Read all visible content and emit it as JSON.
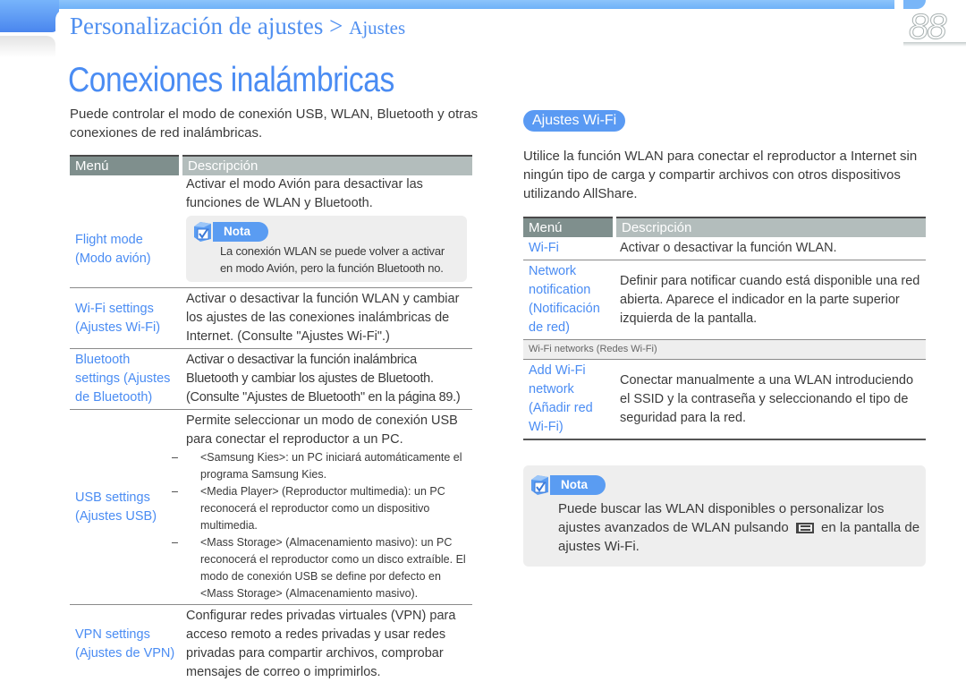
{
  "header": {
    "breadcrumb_main": "Personalización de ajustes",
    "breadcrumb_separator": " > ",
    "breadcrumb_sub": "Ajustes",
    "page_number": "88"
  },
  "title": "Conexiones inalámbricas",
  "intro": "Puede controlar el modo de conexión USB, WLAN, Bluetooth y otras conexiones de red inalámbricas.",
  "left_table": {
    "headers": {
      "menu": "Menú",
      "description": "Descripción"
    },
    "rows": [
      {
        "menu": "Flight mode (Modo avión)",
        "description": "Activar el modo Avión para desactivar las funciones de WLAN y Bluetooth.",
        "note": {
          "label": "Nota",
          "text": "La conexión WLAN se puede volver a activar en modo Avión, pero la función Bluetooth no."
        }
      },
      {
        "menu": "Wi-Fi settings (Ajustes Wi-Fi)",
        "description": "Activar o desactivar la función WLAN y cambiar los ajustes de las conexiones inalámbricas de Internet. (Consulte \"Ajustes Wi-Fi\".)"
      },
      {
        "menu": "Bluetooth settings (Ajustes de Bluetooth)",
        "description": "Activar o desactivar la función inalámbrica Bluetooth y cambiar los ajustes de Bluetooth. (Consulte \"Ajustes de Bluetooth\" en la página 89.)"
      },
      {
        "menu": "USB settings (Ajustes USB)",
        "description": "Permite seleccionar un modo de conexión USB para conectar el reproductor a un PC.",
        "items": [
          "<Samsung Kies>: un PC iniciará automáticamente el programa Samsung Kies.",
          "<Media Player> (Reproductor multimedia): un PC reconocerá el reproductor como un dispositivo multimedia.",
          "<Mass Storage> (Almacenamiento masivo): un PC reconocerá el reproductor como un disco extraíble. El modo de conexión USB se define por defecto en <Mass Storage> (Almacenamiento masivo)."
        ],
        "item_dash": "–"
      },
      {
        "menu": "VPN settings (Ajustes de VPN)",
        "description": "Configurar redes privadas virtuales (VPN) para acceso remoto a redes privadas y usar redes privadas para compartir archivos, comprobar mensajes de correo o imprimirlos."
      }
    ]
  },
  "wifi_section": {
    "label": "Ajustes Wi-Fi",
    "intro": "Utilice la función WLAN para conectar el reproductor a Internet sin ningún tipo de carga y compartir archivos con otros dispositivos utilizando AllShare.",
    "table": {
      "headers": {
        "menu": "Menú",
        "description": "Descripción"
      },
      "rows": [
        {
          "menu": "Wi-Fi",
          "description": "Activar o desactivar la función WLAN."
        },
        {
          "menu": "Network notification (Notificación de red)",
          "description": "Definir para notificar cuando está disponible una red abierta. Aparece el indicador en la parte superior izquierda de la pantalla."
        }
      ],
      "subheading": "Wi-Fi networks (Redes Wi-Fi)",
      "rows_after": [
        {
          "menu": "Add Wi-Fi network (Añadir red Wi-Fi)",
          "description": "Conectar manualmente a una WLAN introduciendo el SSID y la contraseña y seleccionando el tipo de seguridad para la red."
        }
      ]
    },
    "note": {
      "label": "Nota",
      "text_before": "Puede buscar las WLAN disponibles o personalizar los ajustes avanzados de WLAN pulsando",
      "icon": "menu-key-icon",
      "text_after": "en la pantalla de ajustes Wi-Fi."
    }
  },
  "colors": {
    "accent_blue": "#4a8cf3",
    "header_menu": "#7f8f8d",
    "header_desc": "#b3bdbc",
    "note_bg": "#eeeeee"
  }
}
